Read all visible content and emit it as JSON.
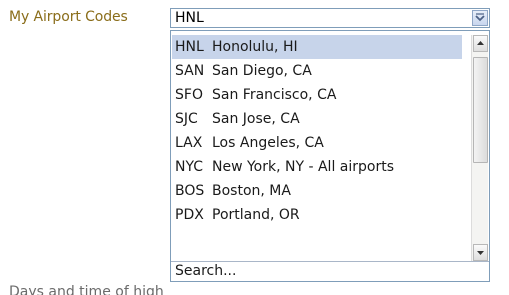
{
  "field": {
    "label": "My Airport Codes",
    "selected_value": "HNL"
  },
  "dropdown": {
    "options": [
      {
        "code": "HNL",
        "name": "Honolulu, HI",
        "selected": true
      },
      {
        "code": "SAN",
        "name": "San Diego, CA",
        "selected": false
      },
      {
        "code": "SFO",
        "name": "San Francisco, CA",
        "selected": false
      },
      {
        "code": "SJC",
        "name": "San Jose, CA",
        "selected": false
      },
      {
        "code": "LAX",
        "name": "Los Angeles, CA",
        "selected": false
      },
      {
        "code": "NYC",
        "name": "New York, NY - All airports",
        "selected": false
      },
      {
        "code": "BOS",
        "name": "Boston, MA",
        "selected": false
      },
      {
        "code": "PDX",
        "name": "Portland, OR",
        "selected": false
      }
    ],
    "search_label": "Search..."
  },
  "footer": {
    "partial_text": "Days and time of high"
  },
  "icons": {
    "select_arrow": "chevron-down-icon",
    "scroll_up": "arrow-up-icon",
    "scroll_down": "arrow-down-icon"
  },
  "colors": {
    "label": "#8a6d1a",
    "selected_row": "#c7d4ea",
    "border": "#7f9db9"
  }
}
